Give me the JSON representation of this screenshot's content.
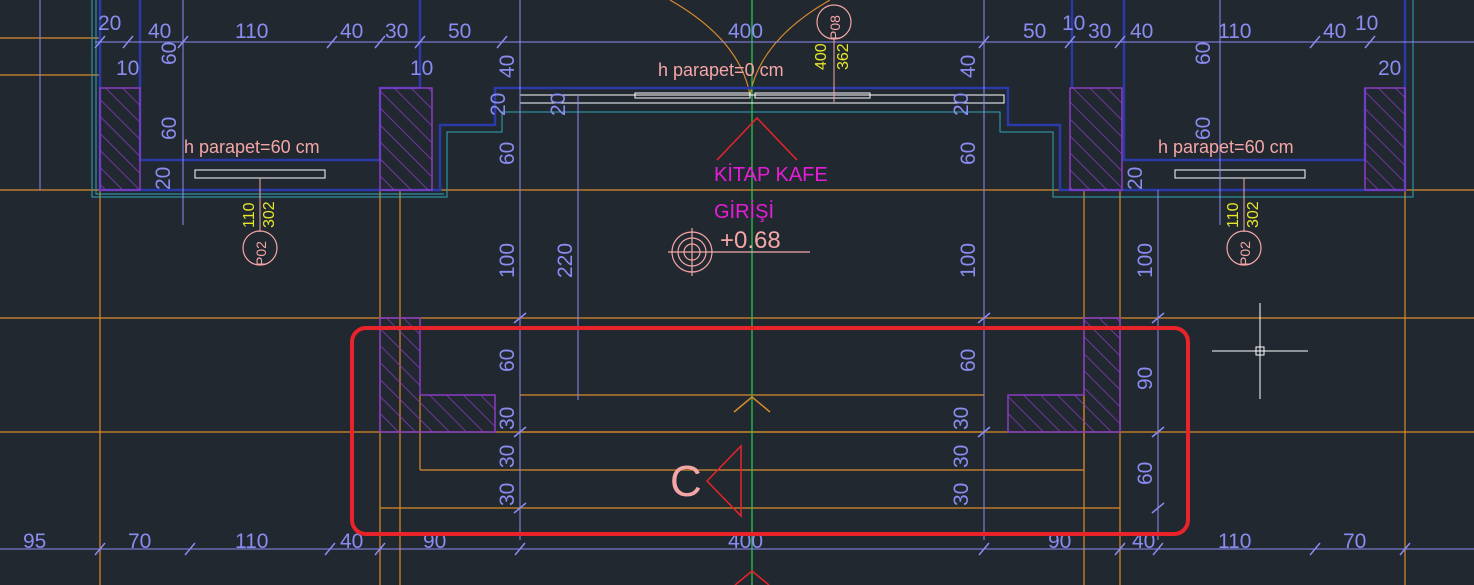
{
  "drawing": {
    "room_label_1": "KİTAP KAFE",
    "room_label_2": "GİRİŞİ",
    "level_mark": "+0.68",
    "section_mark": "C",
    "parapet_center": "h parapet=0 cm",
    "parapet_left": "h parapet=60 cm",
    "parapet_right": "h parapet=60 cm",
    "tag_left": {
      "code": "P02",
      "w": "110",
      "h": "302"
    },
    "tag_right": {
      "code": "P02",
      "w": "110",
      "h": "302"
    },
    "tag_door": {
      "code": "P08",
      "w": "400",
      "h": "362"
    },
    "top_dims": {
      "left": [
        "20",
        "40",
        "110",
        "40",
        "30",
        "50"
      ],
      "center": "400",
      "right": [
        "50",
        "10",
        "30",
        "40",
        "110",
        "40",
        "10"
      ]
    },
    "bottom_dims": [
      "95",
      "70",
      "110",
      "40",
      "90",
      "400",
      "90",
      "40",
      "110",
      "70"
    ],
    "vertical_dims": {
      "left_wing": [
        "60",
        "60",
        "20",
        "10",
        "10"
      ],
      "left_center": [
        "40",
        "20",
        "60",
        "100",
        "60",
        "30",
        "30",
        "30"
      ],
      "stair_inner": [
        "20",
        "220"
      ],
      "right_center": [
        "40",
        "20",
        "60",
        "100",
        "60",
        "30",
        "30",
        "30"
      ],
      "right_wing": [
        "20",
        "100",
        "90",
        "60"
      ],
      "far_right": [
        "60",
        "60",
        "20"
      ]
    }
  },
  "colors": {
    "background": "#212830",
    "dimension": "#8a8cf0",
    "grid": "#d98a2a",
    "wall": "#2a3aa8",
    "hatch": "#8a3cc4",
    "text_pink": "#f4a6a6",
    "text_magenta": "#e81cd8",
    "axis": "#2ad24a",
    "highlight": "#e8232a"
  }
}
